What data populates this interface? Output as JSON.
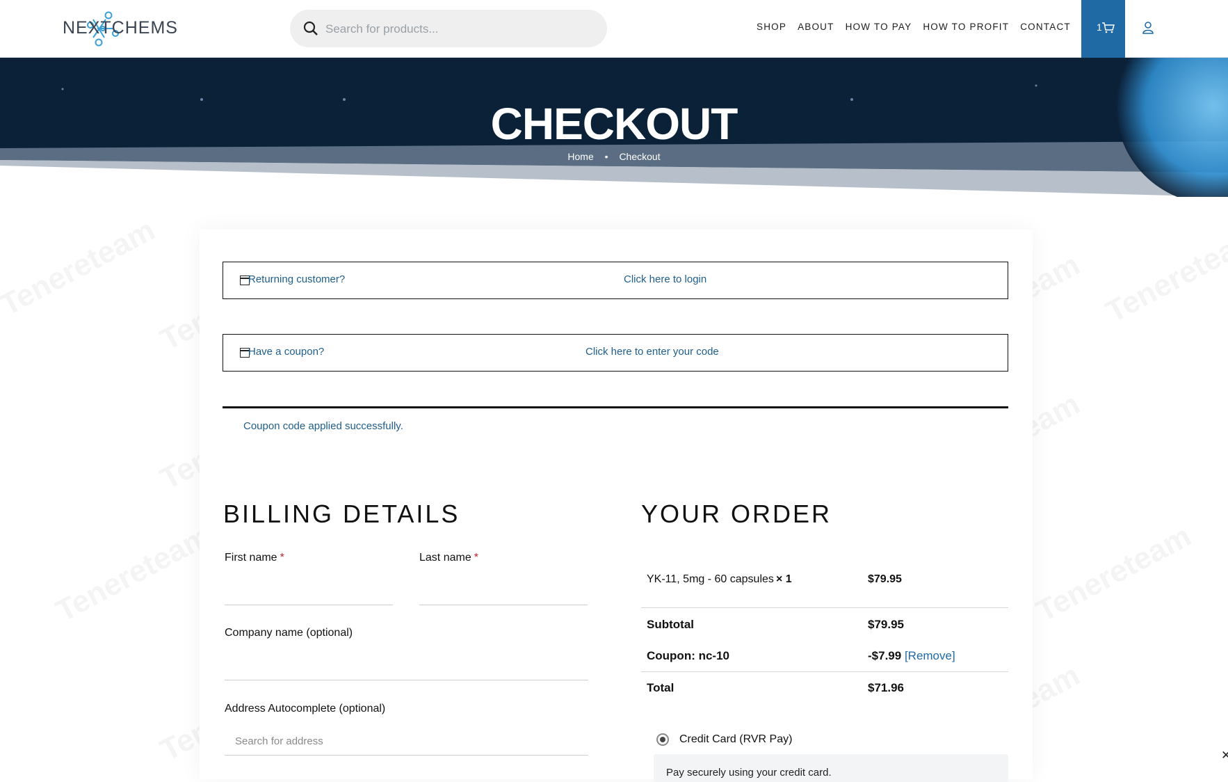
{
  "header": {
    "logo_text": "NEXTCHEMS",
    "search_placeholder": "Search for products...",
    "nav": [
      "SHOP",
      "ABOUT",
      "HOW TO PAY",
      "HOW TO PROFIT",
      "CONTACT"
    ],
    "cart_count": "1"
  },
  "hero": {
    "title": "CHECKOUT",
    "breadcrumb": [
      "Home",
      "Checkout"
    ]
  },
  "notices": {
    "returning_q": "Returning customer?",
    "returning_link": "Click here to login",
    "coupon_q": "Have a coupon?",
    "coupon_link": "Click here to enter your code",
    "success": "Coupon code applied successfully."
  },
  "billing": {
    "title": "BILLING DETAILS",
    "first_name_label": "First name",
    "last_name_label": "Last name",
    "required_mark": "*",
    "company_label": "Company name (optional)",
    "address_label": "Address Autocomplete (optional)",
    "address_placeholder": "Search for address"
  },
  "order": {
    "title": "YOUR ORDER",
    "item_name": "YK-11, 5mg - 60 capsules",
    "item_qty": "× 1",
    "item_price": "$79.95",
    "subtotal_label": "Subtotal",
    "subtotal_value": "$79.95",
    "coupon_label": "Coupon: nc-10",
    "coupon_value": "-$7.99",
    "coupon_remove": "[Remove]",
    "total_label": "Total",
    "total_value": "$71.96",
    "payment_method": "Credit Card (RVR Pay)",
    "payment_desc": "Pay securely using your credit card."
  },
  "watermark": "Tenereteam",
  "colors": {
    "accent": "#1f6aa5",
    "hero_dark": "#0b2138",
    "link": "#1e5e8c"
  }
}
